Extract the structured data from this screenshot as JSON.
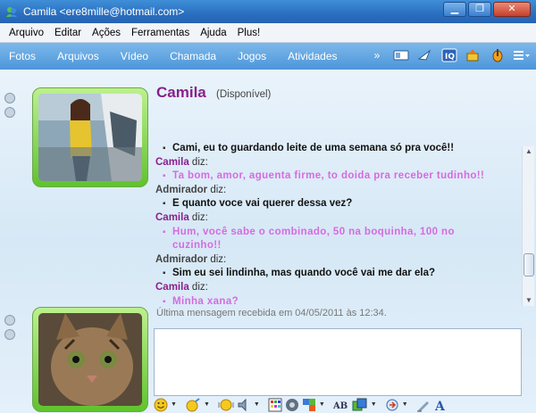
{
  "window": {
    "title": "Camila <ere8mille@hotmail.com>",
    "buttons": [
      "▁",
      "❐",
      "✕"
    ]
  },
  "menu": [
    "Arquivo",
    "Editar",
    "Ações",
    "Ferramentas",
    "Ajuda",
    "Plus!"
  ],
  "toolbar": {
    "items": [
      "Fotos",
      "Arquivos",
      "Vídeo",
      "Chamada",
      "Jogos",
      "Atividades"
    ],
    "overflow": "»",
    "right_icons": [
      "contact-card-icon",
      "send-file-icon",
      "iq-icon",
      "paint-icon",
      "guitar-icon",
      "menu-icon"
    ]
  },
  "contact": {
    "name": "Camila",
    "status": "(Disponível)"
  },
  "conversation": [
    {
      "type": "msg",
      "who": "user",
      "text": "Cami, eu to guardando leite de uma semana só pra você!!"
    },
    {
      "type": "sender",
      "who": "camila",
      "name": "Camila",
      "suffix": "diz:"
    },
    {
      "type": "msg",
      "who": "camila",
      "text": "Ta bom, amor, aguenta firme, to doida pra receber tudinho!!"
    },
    {
      "type": "sender",
      "who": "admirador",
      "name": "Admirador",
      "suffix": "diz:"
    },
    {
      "type": "msg",
      "who": "user",
      "text": "E quanto voce vai querer dessa vez?"
    },
    {
      "type": "sender",
      "who": "camila",
      "name": "Camila",
      "suffix": "diz:"
    },
    {
      "type": "msg",
      "who": "camila",
      "text": "Hum, você sabe o combinado, 50 na boquinha, 100 no"
    },
    {
      "type": "cont",
      "who": "camila",
      "text": "cuzinho!!"
    },
    {
      "type": "sender",
      "who": "admirador",
      "name": "Admirador",
      "suffix": "diz:"
    },
    {
      "type": "msg",
      "who": "user",
      "text": "Sim eu sei lindinha, mas quando você vai me dar ela?"
    },
    {
      "type": "sender",
      "who": "camila",
      "name": "Camila",
      "suffix": "diz:"
    },
    {
      "type": "msg",
      "who": "camila",
      "text": "Minha xana?"
    }
  ],
  "last_message": "Última mensagem recebida em 04/05/2011 às 12:34.",
  "input": {
    "value": ""
  },
  "colors": {
    "camila_name": "#8a1f8b",
    "camila_msg": "#d56be0",
    "toolbar": "#4d96da"
  }
}
